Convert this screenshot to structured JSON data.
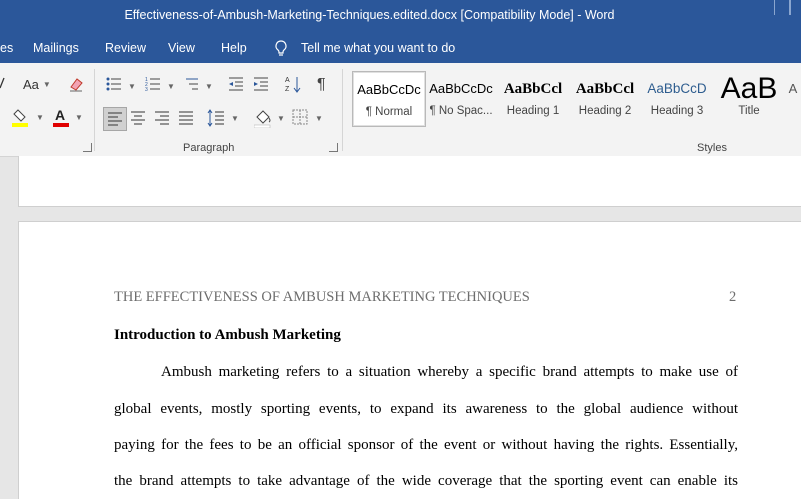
{
  "window": {
    "title": "Effectiveness-of-Ambush-Marketing-Techniques.edited.docx [Compatibility Mode]  -  Word"
  },
  "menu": {
    "tabs": [
      "es",
      "Mailings",
      "Review",
      "View",
      "Help"
    ],
    "tell_me": "Tell me what you want to do"
  },
  "ribbon": {
    "font": {
      "case_label": "Aa"
    },
    "groups": {
      "paragraph": "Paragraph",
      "styles": "Styles"
    },
    "styles": [
      {
        "preview": "AaBbCcDc",
        "name": "¶ Normal"
      },
      {
        "preview": "AaBbCcDc",
        "name": "¶ No Spac..."
      },
      {
        "preview": "AaBbCcl",
        "name": "Heading 1"
      },
      {
        "preview": "AaBbCcl",
        "name": "Heading 2"
      },
      {
        "preview": "AaBbCcD",
        "name": "Heading 3"
      },
      {
        "preview": "AaB",
        "name": "Title"
      },
      {
        "preview": "A",
        "name": ""
      }
    ]
  },
  "document": {
    "running_head": "THE EFFECTIVENESS OF AMBUSH MARKETING TECHNIQUES",
    "page_number": "2",
    "heading": "Introduction to Ambush Marketing",
    "lines": [
      "Ambush marketing refers to a situation whereby a specific brand attempts to make use of",
      "global events, mostly sporting events, to expand its awareness to the global audience without",
      "paying for the fees to be an official sponsor of the event or without having the rights. Essentially,",
      "the brand attempts to take advantage of the wide coverage that the sporting event can enable its"
    ]
  },
  "colors": {
    "title_bar": "#2b579a",
    "ribbon_bg": "#f3f3f3",
    "canvas": "#e6e6e6",
    "font_color_red": "#e00000",
    "highlight_yellow": "#ffff00"
  }
}
